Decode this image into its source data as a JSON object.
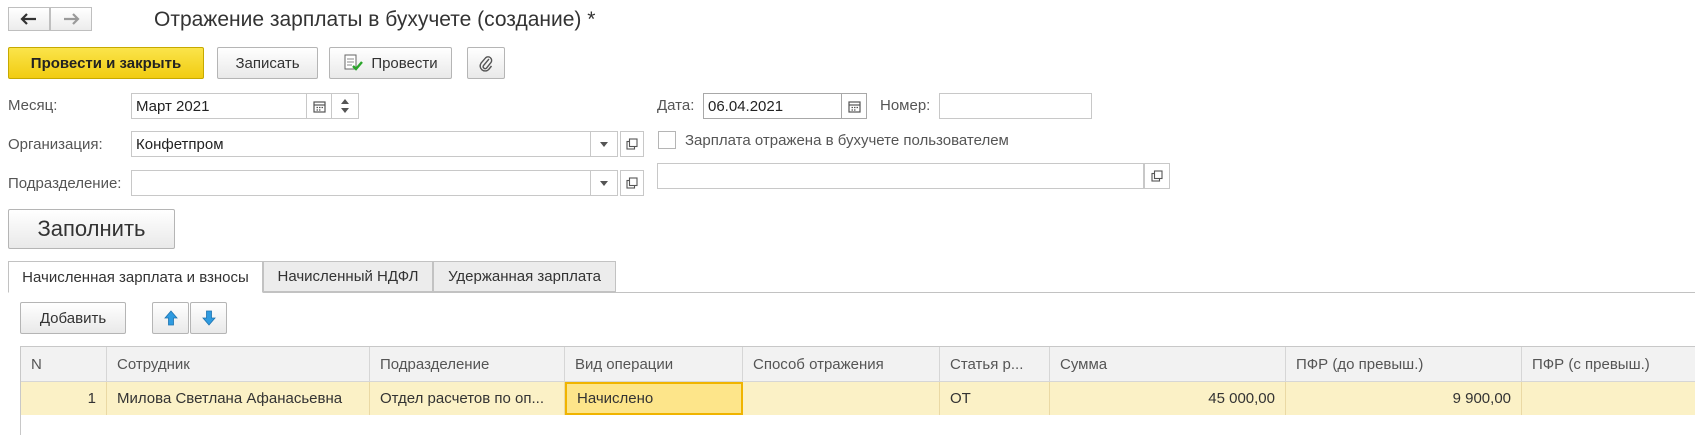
{
  "window": {
    "title": "Отражение зарплаты в бухучете (создание) *"
  },
  "toolbar": {
    "post_close_label": "Провести и закрыть",
    "save_label": "Записать",
    "post_label": "Провести"
  },
  "form": {
    "month_label": "Месяц:",
    "month_value": "Март 2021",
    "org_label": "Организация:",
    "org_value": "Конфетпром",
    "dept_label": "Подразделение:",
    "dept_value": "",
    "date_label": "Дата:",
    "date_value": "06.04.2021",
    "number_label": "Номер:",
    "number_value": "",
    "checkbox_label": "Зарплата отражена в бухучете пользователем",
    "checkbox_checked": false,
    "fill_label": "Заполнить"
  },
  "tabs": [
    {
      "label": "Начисленная зарплата и взносы",
      "active": true
    },
    {
      "label": "Начисленный НДФЛ",
      "active": false
    },
    {
      "label": "Удержанная зарплата",
      "active": false
    }
  ],
  "table": {
    "add_label": "Добавить",
    "columns": [
      "N",
      "Сотрудник",
      "Подразделение",
      "Вид операции",
      "Способ отражения",
      "Статья р...",
      "Сумма",
      "ПФР (до превыш.)",
      "ПФР (с превыш.)"
    ],
    "rows": [
      [
        "1",
        "Милова Светлана Афанасьевна",
        "Отдел расчетов по оп...",
        "Начислено",
        "",
        "ОТ",
        "45 000,00",
        "9 900,00",
        ""
      ]
    ]
  },
  "colors": {
    "primary_button": "#f5d418",
    "selected_row": "#fbf1c6",
    "selected_cell_border": "#f0b400",
    "arrow_blue": "#2f9be0"
  }
}
